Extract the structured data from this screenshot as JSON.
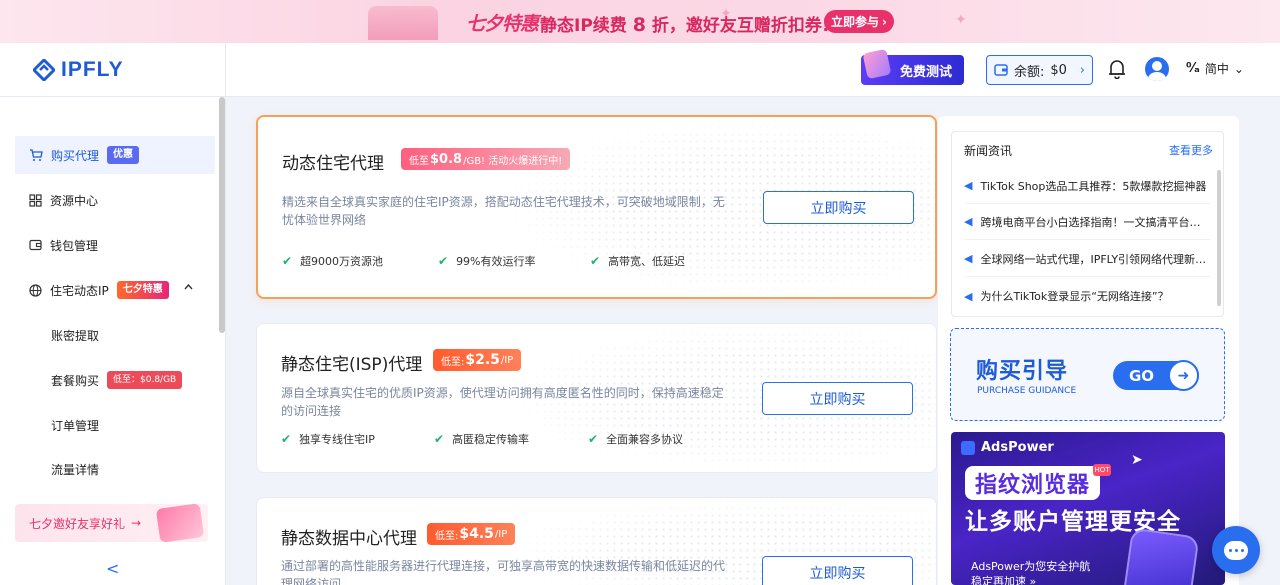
{
  "banner": {
    "brand": "七夕特惠",
    "message_pre": "静态IP续费",
    "message_num": "8",
    "message_post": "折，邀好友互赠折扣券!",
    "join_label": "立即参与"
  },
  "header": {
    "logo_text": "IPFLY",
    "free_test_label": "免费测试",
    "balance_label": "余额:",
    "balance_value": "$0",
    "language_label": "简中"
  },
  "sidebar": {
    "items": [
      {
        "label": "购买代理",
        "tag": "优惠"
      },
      {
        "label": "资源中心"
      },
      {
        "label": "钱包管理"
      },
      {
        "label": "住宅动态IP",
        "tag": "七夕特惠"
      }
    ],
    "sub_items": [
      {
        "label": "账密提取"
      },
      {
        "label": "套餐购买",
        "tag": "低至：$0.8/GB"
      },
      {
        "label": "订单管理"
      },
      {
        "label": "流量详情"
      }
    ],
    "promo_label": "七夕邀好友享好礼"
  },
  "products": [
    {
      "title": "动态住宅代理",
      "badge_pre": "低至",
      "badge_price": "$0.8",
      "badge_post": "/GB! 活动火爆进行中!",
      "desc": "精选来自全球真实家庭的住宅IP资源，搭配动态住宅代理技术，可突破地域限制，无忧体验世界网络",
      "features": [
        "超9000万资源池",
        "99%有效运行率",
        "高带宽、低延迟"
      ],
      "buy_label": "立即购买"
    },
    {
      "title": "静态住宅(ISP)代理",
      "badge_pre": "低至: ",
      "badge_price": "$2.5",
      "badge_post": "/IP",
      "desc": "源自全球真实住宅的优质IP资源，使代理访问拥有高度匿名性的同时，保持高速稳定的访问连接",
      "features": [
        "独享专线住宅IP",
        "高匿稳定传输率",
        "全面兼容多协议"
      ],
      "buy_label": "立即购买"
    },
    {
      "title": "静态数据中心代理",
      "badge_pre": "低至: ",
      "badge_price": "$4.5",
      "badge_post": "/IP",
      "desc": "通过部署的高性能服务器进行代理连接，可独享高带宽的快速数据传输和低延迟的代理网络访问",
      "buy_label": "立即购买"
    }
  ],
  "news": {
    "title": "新闻资讯",
    "more_label": "查看更多",
    "items": [
      "TikTok Shop选品工具推荐：5款爆款挖掘神器",
      "跨境电商平台小白选择指南！一文搞清平台差异",
      "全球网络一站式代理，IPFLY引领网络代理新潮流",
      "为什么TikTok登录显示“无网络连接”？"
    ]
  },
  "guide": {
    "title": "购买引导",
    "subtitle": "PURCHASE GUIDANCE",
    "go_label": "GO"
  },
  "ad": {
    "brand": "AdsPower",
    "headline1": "指纹浏览器",
    "hot_tag": "HOT",
    "headline2": "让多账户管理更安全",
    "line1": "AdsPower为您安全护航",
    "line2": "稳定再加速 »"
  },
  "colors": {
    "primary": "#2a6ef0",
    "banner_accent": "#e8316a",
    "highlight_border": "#f5a15a"
  }
}
